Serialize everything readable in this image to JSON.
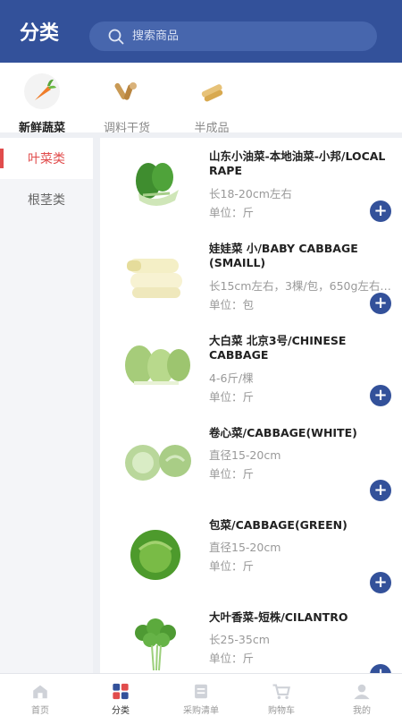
{
  "header": {
    "title": "分类"
  },
  "search": {
    "placeholder": "搜索商品",
    "icon": "search-icon"
  },
  "categories": [
    {
      "label": "新鲜蔬菜",
      "icon": "carrot-icon",
      "active": true
    },
    {
      "label": "调料干货",
      "icon": "dried-goods-icon",
      "active": false
    },
    {
      "label": "半成品",
      "icon": "semi-finished-icon",
      "active": false
    }
  ],
  "sidebar": {
    "items": [
      {
        "label": "叶菜类",
        "active": true
      },
      {
        "label": "根茎类",
        "active": false
      }
    ]
  },
  "products": [
    {
      "name": "山东小油菜-本地油菜-小邦/LOCAL RAPE",
      "spec": "长18-20cm左右",
      "unit": "单位：斤",
      "image": "bok-choy"
    },
    {
      "name": "娃娃菜 小/BABY CABBAGE (SMAILL)",
      "spec": "长15cm左右，3棵/包，650g左右/包",
      "unit": "单位：包",
      "image": "baby-cabbage"
    },
    {
      "name": "大白菜 北京3号/CHINESE CABBAGE",
      "spec": "4-6斤/棵",
      "unit": "单位：斤",
      "image": "chinese-cabbage"
    },
    {
      "name": "卷心菜/CABBAGE(WHITE)",
      "spec": "直径15-20cm",
      "unit": "单位：斤",
      "image": "white-cabbage"
    },
    {
      "name": "包菜/CABBAGE(GREEN)",
      "spec": "直径15-20cm",
      "unit": "单位：斤",
      "image": "green-cabbage"
    },
    {
      "name": "大叶香菜-短株/CILANTRO",
      "spec": "长25-35cm",
      "unit": "单位：斤",
      "image": "cilantro"
    }
  ],
  "tabbar": [
    {
      "label": "首页",
      "icon": "home-icon",
      "active": false
    },
    {
      "label": "分类",
      "icon": "category-icon",
      "active": true
    },
    {
      "label": "采购清单",
      "icon": "list-icon",
      "active": false
    },
    {
      "label": "购物车",
      "icon": "cart-icon",
      "active": false
    },
    {
      "label": "我的",
      "icon": "profile-icon",
      "active": false
    }
  ],
  "colors": {
    "primary": "#33519a",
    "accent_red": "#e14c4c"
  }
}
